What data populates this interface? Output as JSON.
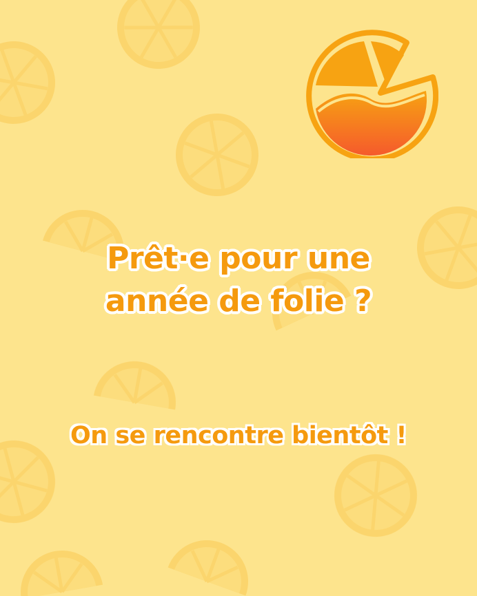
{
  "headline": {
    "line1": "Prêt·e pour une",
    "line2": "année de folie ?"
  },
  "subheadline": "On se rencontre bientôt !",
  "logo": {
    "icon": "orange-slice-logo-icon"
  },
  "background": {
    "pattern_icon": "orange-slice-pattern-icon"
  },
  "colors": {
    "background": "#fde48d",
    "text": "#f59a0e",
    "text_outline": "#ffffff",
    "logo_orange": "#f7a312",
    "logo_gradient_end": "#f55a2c"
  }
}
